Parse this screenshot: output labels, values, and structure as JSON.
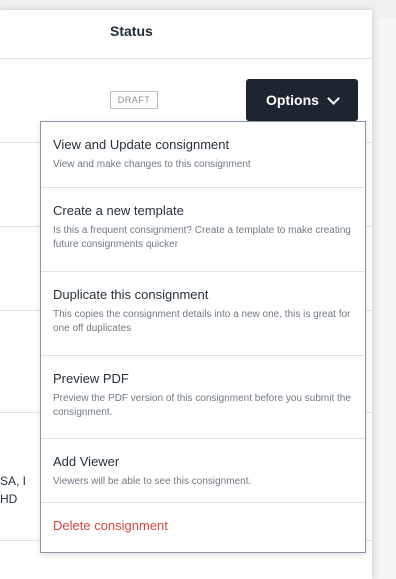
{
  "table": {
    "status_heading": "Status",
    "row1_status": "DRAFT",
    "options_label": "Options",
    "partial_line1": "SA, I",
    "partial_line2": "HD"
  },
  "menu": {
    "items": [
      {
        "title": "View and Update consignment",
        "desc": "View and make changes to this consignment"
      },
      {
        "title": "Create a new template",
        "desc": "Is this a frequent consignment? Create a template to make creating future consignments quicker"
      },
      {
        "title": "Duplicate this consignment",
        "desc": "This copies the consignment details into a new one, this is great for one off duplicates"
      },
      {
        "title": "Preview PDF",
        "desc": "Preview the PDF version of this consignment before you submit the consignment."
      },
      {
        "title": "Add Viewer",
        "desc": "Viewers will be able to see this consignment."
      },
      {
        "title": "Delete consignment"
      }
    ]
  },
  "colors": {
    "button_bg": "#1d2630",
    "danger": "#d8473c",
    "border": "#dfe3e7"
  },
  "icons": {
    "options_chevron": "chevron-down-icon"
  }
}
